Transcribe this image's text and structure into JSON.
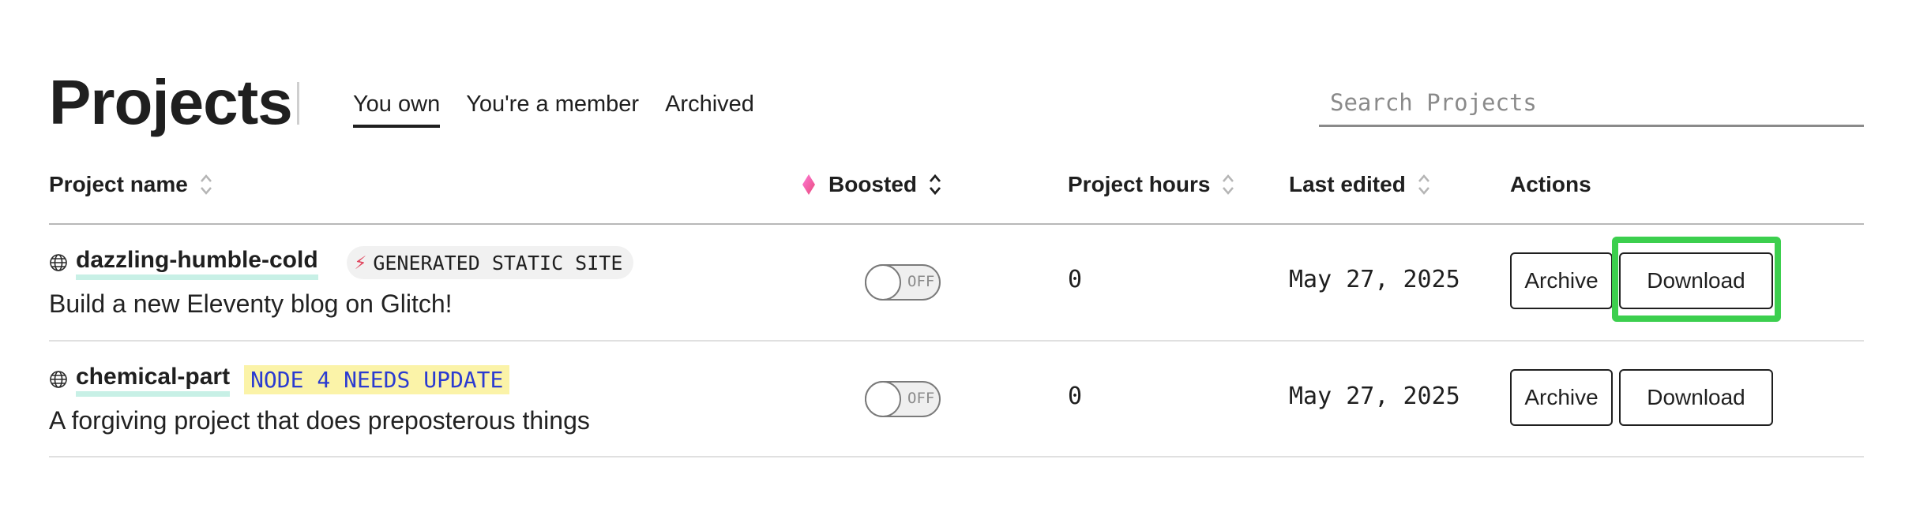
{
  "header": {
    "title": "Projects",
    "tabs": [
      {
        "label": "You own",
        "active": true
      },
      {
        "label": "You're a member",
        "active": false
      },
      {
        "label": "Archived",
        "active": false
      }
    ],
    "search": {
      "placeholder": "Search Projects",
      "value": ""
    }
  },
  "table": {
    "columns": {
      "name": "Project name",
      "boosted": "Boosted",
      "hours": "Project hours",
      "edited": "Last edited",
      "actions": "Actions"
    },
    "rows": [
      {
        "name": "dazzling-humble-cold",
        "badge": "GENERATED STATIC SITE",
        "description": "Build a new Eleventy blog on Glitch!",
        "boosted": "OFF",
        "hours": "0",
        "last_edited": "May 27, 2025",
        "archive_label": "Archive",
        "download_label": "Download"
      },
      {
        "name": "chemical-part",
        "badge": "NODE 4 NEEDS UPDATE",
        "description": "A forgiving project that does preposterous things",
        "boosted": "OFF",
        "hours": "0",
        "last_edited": "May 27, 2025",
        "archive_label": "Archive",
        "download_label": "Download"
      }
    ]
  },
  "icons": {
    "globe": "globe-icon",
    "sort": "sort-icon",
    "diamond": "diamond-icon",
    "bolt": "bolt-icon"
  },
  "colors": {
    "name_underline": "#c8f0e6",
    "update_badge_bg": "#fbf3a8",
    "update_badge_text": "#2b3bd1",
    "highlight": "#3ccf4e",
    "bolt": "#e0435c"
  }
}
